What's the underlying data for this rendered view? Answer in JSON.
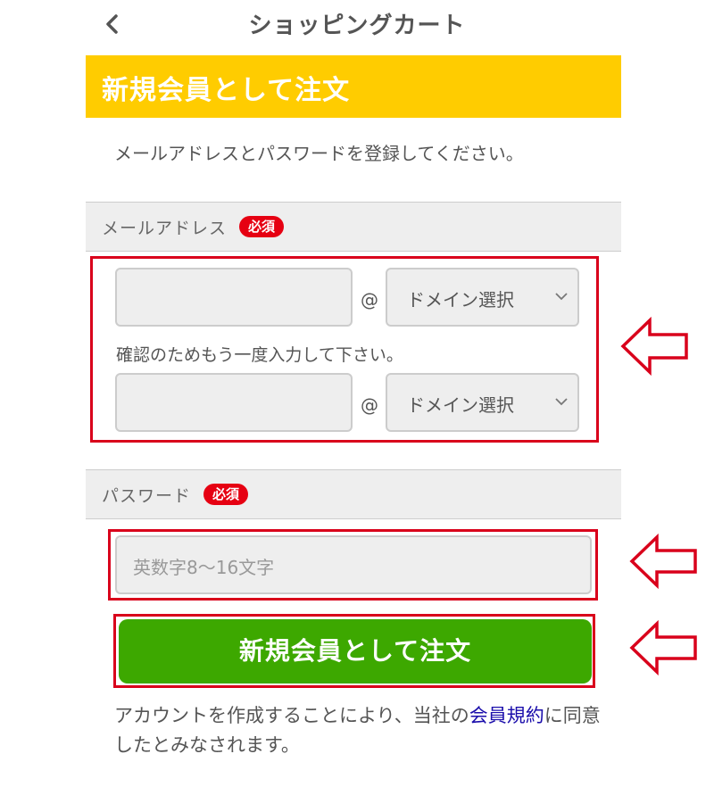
{
  "header": {
    "title": "ショッピングカート",
    "back_icon": "chevron-left-icon"
  },
  "banner": {
    "title": "新規会員として注文",
    "color": "#ffcc00"
  },
  "intro_text": "メールアドレスとパスワードを登録してください。",
  "email_section": {
    "label": "メールアドレス",
    "required_badge": "必須",
    "at_symbol": "@",
    "domain_select_value": "ドメイン選択",
    "confirm_text": "確認のためもう一度入力して下さい。",
    "confirm_at_symbol": "@",
    "confirm_domain_select_value": "ドメイン選択"
  },
  "password_section": {
    "label": "パスワード",
    "required_badge": "必須",
    "placeholder": "英数字8〜16文字"
  },
  "submit_button": {
    "label": "新規会員として注文",
    "color": "#3da800"
  },
  "terms": {
    "before_link": "アカウントを作成することにより、当社の",
    "link_text": "会員規約",
    "after_link": "に同意したとみなされます。"
  },
  "annotation_color": "#d9001b"
}
